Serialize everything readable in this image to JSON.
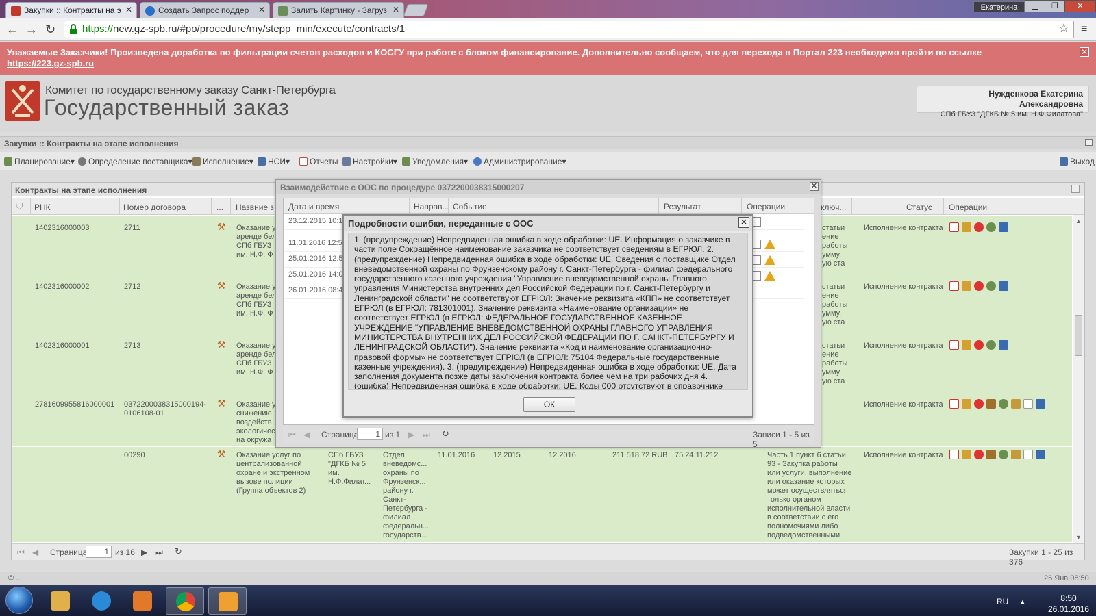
{
  "browser": {
    "tabs": [
      {
        "label": "Закупки :: Контракты на э"
      },
      {
        "label": "Создать Запрос поддер"
      },
      {
        "label": "Залить Картинку - Загруз"
      }
    ],
    "user_badge": "Екатерина",
    "url_scheme": "https://",
    "url_rest": "new.gz-spb.ru/#po/procedure/my/stepp_min/execute/contracts/1"
  },
  "banner": {
    "text": "Уважаемые Заказчики! Произведена доработка по фильтрации счетов расходов и КОСГУ при работе с блоком финансирование. Дополнительно сообщаем, что для перехода в Портал 223 необходимо пройти по ссылке",
    "link": "https://223.gz-spb.ru"
  },
  "header": {
    "org_line1": "Комитет по государственному заказу Санкт-Петербурга",
    "org_line2": "Государственный заказ",
    "user_name": "Нужденкова Екатерина Александровна",
    "user_org": "СПб ГБУЗ \"ДГКБ № 5 им. Н.Ф.Филатова\""
  },
  "breadcrumb": "Закупки :: Контракты на этапе исполнения",
  "menu": [
    {
      "label": "Планирование",
      "color": "#6b8e4e"
    },
    {
      "label": "Определение поставщика",
      "color": "#777777"
    },
    {
      "label": "Исполнение",
      "color": "#8a7a5a"
    },
    {
      "label": "НСИ",
      "color": "#4a6fa5"
    },
    {
      "label": "Отчеты",
      "color": "#b05050"
    },
    {
      "label": "Настройки",
      "color": "#6a7a9a"
    },
    {
      "label": "Уведомления",
      "color": "#6b8e4e"
    },
    {
      "label": "Администрирование",
      "color": "#4a78c2"
    }
  ],
  "logout": "Выход",
  "grid": {
    "title": "Контракты на этапе исполнения",
    "headers": [
      "РНК",
      "Номер договора",
      "...",
      "Назвние з",
      "ключ...",
      "Статус",
      "Операции"
    ],
    "rows": [
      {
        "rnk": "1402316000003",
        "num": "2711",
        "name": "Оказание у\nаренде бел\nСПб ГБУЗ\nим. Н.Ф. Ф",
        "reason": "статьи\nение\nработы\nумму,\nую ста",
        "status": "Исполнение контракта"
      },
      {
        "rnk": "1402316000002",
        "num": "2712",
        "name": "Оказание у\nаренде бел\nСПб ГБУЗ\nим. Н.Ф. Ф",
        "reason": "статьи\nение\nработы\nумму,\nую ста",
        "status": "Исполнение контракта"
      },
      {
        "rnk": "1402316000001",
        "num": "2713",
        "name": "Оказание у\nаренде бел\nСПб ГБУЗ\nим. Н.Ф. Ф",
        "reason": "статьи\nение\nработы\nумму,\nую ста",
        "status": "Исполнение контракта"
      },
      {
        "rnk": "2781609955816000001",
        "num": "0372200038315000194-\n0106108-01",
        "name": "Оказание у\nснижению\nвоздейств\nэкологичес\nна окружа",
        "reason": "",
        "status": "Исполнение контракта"
      }
    ],
    "last_row": {
      "num": "00290",
      "name": "Оказание услуг по\nцентрализованной\nохране и экстренном\nвызове полиции\n(Группа объектов 2)",
      "customer": "СПб ГБУЗ\n\"ДГКБ № 5\nим.\nН.Ф.Филат...",
      "supplier": "Отдел\nвневедомс...\nохраны по\nФрунзенск...\nрайону г.\nСанкт-\nПетербурга -\nфилиал\nфедеральн...\nгосударств...",
      "date1": "11.01.2016",
      "date2": "12.2015",
      "date3": "12.2016",
      "sum": "211 518,72 RUB",
      "code": "75.24.11.212",
      "reason": "Часть 1 пункт 6 статьи\n93 - Закупка работы\nили услуги, выполнение\nили оказание которых\nможет осуществляться\nтолько органом\nисполнительной власти\nв соответствии с его\nполномочиями либо\nподведомственными",
      "status": "Исполнение контракта"
    },
    "footer": {
      "page_label": "Страница",
      "page": "1",
      "of": "из 16",
      "records": "Закупки 1 - 25 из 376"
    }
  },
  "status_left": "© ...",
  "status_right": "26 Янв 08:50",
  "taskbar": {
    "lang": "RU",
    "time": "8:50",
    "date": "26.01.2016"
  },
  "dialog1": {
    "title": "Взаимодействие с ООС по процедуре 0372200038315000207",
    "headers": [
      "Дата и время",
      "Направ...",
      "Событие",
      "Результат",
      "Операции"
    ],
    "rows": [
      "23.12.2015 10:1",
      "11.01.2016 12:5",
      "25.01.2016 12:5",
      "25.01.2016 14:0",
      "26.01.2016 08:4"
    ],
    "footer": {
      "page_label": "Страница",
      "page": "1",
      "of": "из 1",
      "records": "Записи 1 - 5 из 5"
    }
  },
  "dialog2": {
    "title": "Подробности ошибки, переданные с ООС",
    "body": "1. (предупреждение) Непредвиденная ошибка в ходе обработки: UE. Информация о заказчике в части поле Сокращённое наименование заказчика не соответствует сведениям в ЕГРЮЛ. 2. (предупреждение) Непредвиденная ошибка в ходе обработки: UE. Сведения о поставщике Отдел вневедомственной охраны по Фрунзенскому району г. Санкт-Петербурга - филиал федерального государственного казенного учреждения \"Управление вневедомственной охраны Главного управления Министерства внутренних дел Российской Федерации по г. Санкт-Петербургу и Ленинградской области\" не соответствуют ЕГРЮЛ: Значение реквизита «КПП» не соответствует ЕГРЮЛ (в ЕГРЮЛ: 781301001). Значение реквизита «Наименование организации» не соответствует ЕГРЮЛ (в ЕГРЮЛ: ФЕДЕРАЛЬНОЕ ГОСУДАРСТВЕННОЕ КАЗЕННОЕ УЧРЕЖДЕНИЕ \"УПРАВЛЕНИЕ ВНЕВЕДОМСТВЕННОЙ ОХРАНЫ ГЛАВНОГО УПРАВЛЕНИЯ МИНИСТЕРСТВА ВНУТРЕННИХ ДЕЛ РОССИЙСКОЙ ФЕДЕРАЦИИ ПО Г. САНКТ-ПЕТЕРБУРГУ И ЛЕНИНГРАДСКОЙ ОБЛАСТИ\"). Значение реквизита «Код и наименование организационно-правовой формы» не соответствует ЕГРЮЛ (в ЕГРЮЛ: 75104 Федеральные государственные казенные учреждения). 3. (предупреждение) Непредвиденная ошибка в ходе обработки: UE. Дата заполнения документа позже даты заключения контракта более чем на три рабочих дня 4. (ошибка) Непредвиденная ошибка в ходе обработки: UE. Коды 000 отсутствуют в справочнике кодов видов расхода",
    "ok": "ОК"
  }
}
